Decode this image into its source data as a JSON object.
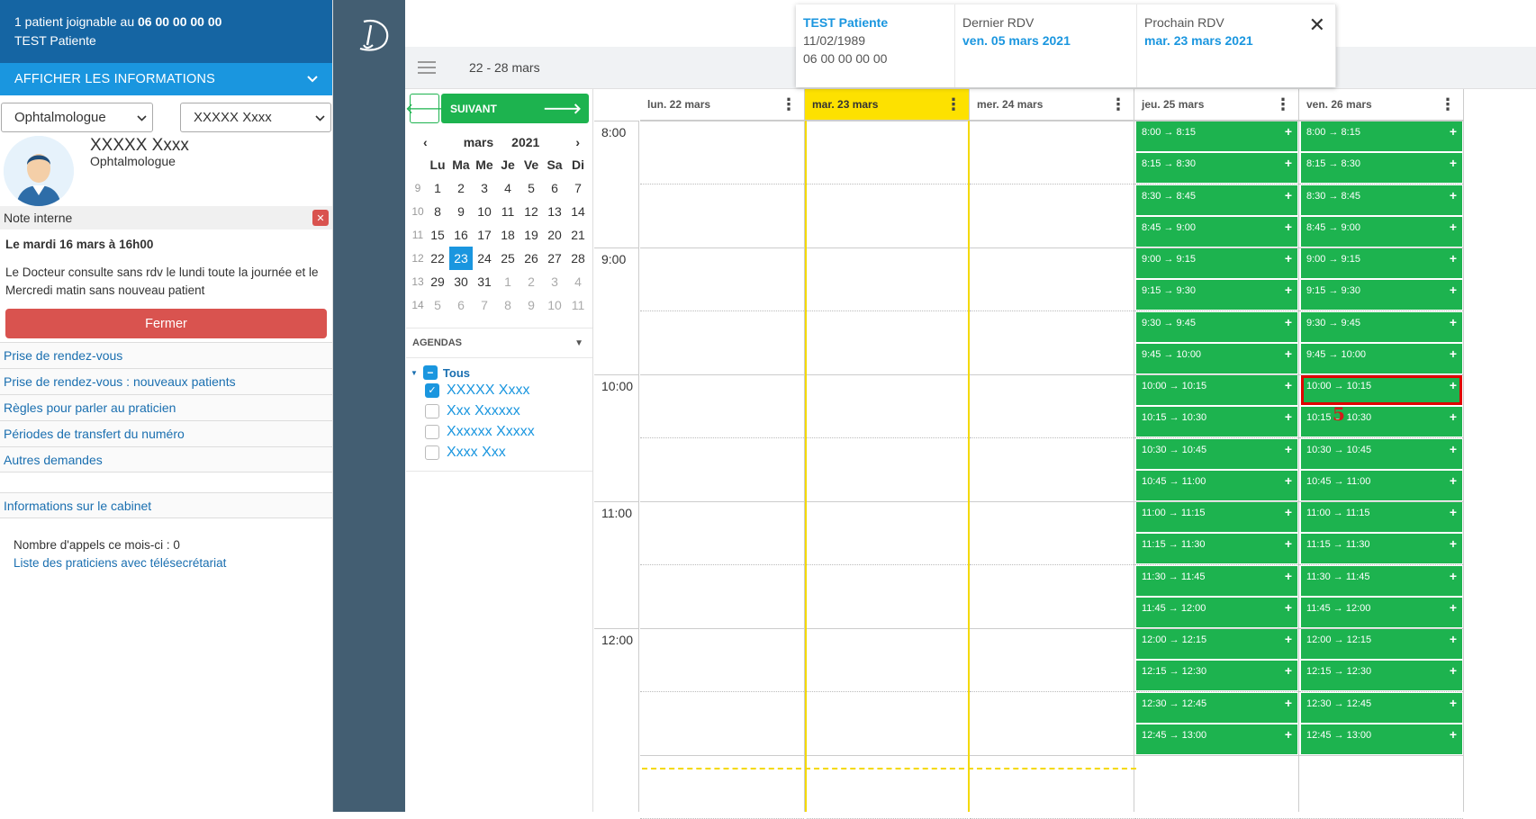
{
  "banner": {
    "line1_prefix": "1 patient joignable au",
    "line1_phone": "06 00 00 00 00",
    "line2": "TEST Patiente"
  },
  "show_info_label": "AFFICHER LES INFORMATIONS",
  "selects": {
    "speciality": "Ophtalmologue",
    "practitioner": "XXXXX Xxxx"
  },
  "profile": {
    "name": "XXXXX Xxxx",
    "speciality": "Ophtalmologue"
  },
  "note": {
    "title": "Note interne",
    "date": "Le mardi 16 mars à 16h00",
    "text": "Le Docteur consulte sans rdv le lundi toute la journée et le Mercredi matin sans nouveau patient",
    "close_label": "Fermer"
  },
  "links": [
    "Prise de rendez-vous",
    "Prise de rendez-vous : nouveaux patients",
    "Règles pour parler au praticien",
    "Périodes de transfert du numéro",
    "Autres demandes"
  ],
  "cabinet_label": "Informations sur le cabinet",
  "calls": {
    "count_text": "Nombre d'appels ce mois-ci : 0",
    "list_link": "Liste des praticiens avec télésecrétariat"
  },
  "topbar": {
    "range": "22 - 28 mars"
  },
  "patient_card": {
    "name": "TEST Patiente",
    "birthdate": "11/02/1989",
    "phone": "06 00 00 00 00",
    "last_label": "Dernier RDV",
    "last_date": "ven. 05 mars 2021",
    "next_label": "Prochain RDV",
    "next_date": "mar. 23 mars 2021"
  },
  "nav": {
    "next_label": "SUIVANT"
  },
  "mini_calendar": {
    "month": "mars",
    "year": "2021",
    "weekdays": [
      "Lu",
      "Ma",
      "Me",
      "Je",
      "Ve",
      "Sa",
      "Di"
    ],
    "weeks": [
      {
        "wk": "9",
        "days": [
          "1",
          "2",
          "3",
          "4",
          "5",
          "6",
          "7"
        ]
      },
      {
        "wk": "10",
        "days": [
          "8",
          "9",
          "10",
          "11",
          "12",
          "13",
          "14"
        ]
      },
      {
        "wk": "11",
        "days": [
          "15",
          "16",
          "17",
          "18",
          "19",
          "20",
          "21"
        ]
      },
      {
        "wk": "12",
        "days": [
          "22",
          "23",
          "24",
          "25",
          "26",
          "27",
          "28"
        ]
      },
      {
        "wk": "13",
        "days": [
          "29",
          "30",
          "31",
          "1",
          "2",
          "3",
          "4"
        ]
      },
      {
        "wk": "14",
        "days": [
          "5",
          "6",
          "7",
          "8",
          "9",
          "10",
          "11"
        ]
      }
    ],
    "selected": "23"
  },
  "agendas": {
    "header": "AGENDAS",
    "all_label": "Tous",
    "items": [
      {
        "label": "XXXXX Xxxx",
        "checked": true
      },
      {
        "label": "Xxx Xxxxxx",
        "checked": false
      },
      {
        "label": "Xxxxxx Xxxxx",
        "checked": false
      },
      {
        "label": "Xxxx Xxx",
        "checked": false
      }
    ]
  },
  "calendar": {
    "days": [
      "lun. 22 mars",
      "mar. 23 mars",
      "mer. 24 mars",
      "jeu. 25 mars",
      "ven. 26 mars"
    ],
    "today_index": 1,
    "hours": [
      "8:00",
      "9:00",
      "10:00",
      "11:00",
      "12:00"
    ],
    "slots": [
      "8:00 → 8:15",
      "8:15 → 8:30",
      "8:30 → 8:45",
      "8:45 → 9:00",
      "9:00 → 9:15",
      "9:15 → 9:30",
      "9:30 → 9:45",
      "9:45 → 10:00",
      "10:00 → 10:15",
      "10:15 → 10:30",
      "10:30 → 10:45",
      "10:45 → 11:00",
      "11:00 → 11:15",
      "11:15 → 11:30",
      "11:30 → 11:45",
      "11:45 → 12:00",
      "12:00 → 12:15",
      "12:15 → 12:30",
      "12:30 → 12:45",
      "12:45 → 13:00"
    ],
    "slot_days": [
      3,
      4
    ],
    "highlight": {
      "day": 4,
      "slot": 8
    },
    "marker_label": "5"
  },
  "colors": {
    "brand_blue": "#1565a3",
    "accent_blue": "#1a96df",
    "slot_green": "#1db34f",
    "today_yellow": "#fde100",
    "danger": "#d9534f"
  }
}
